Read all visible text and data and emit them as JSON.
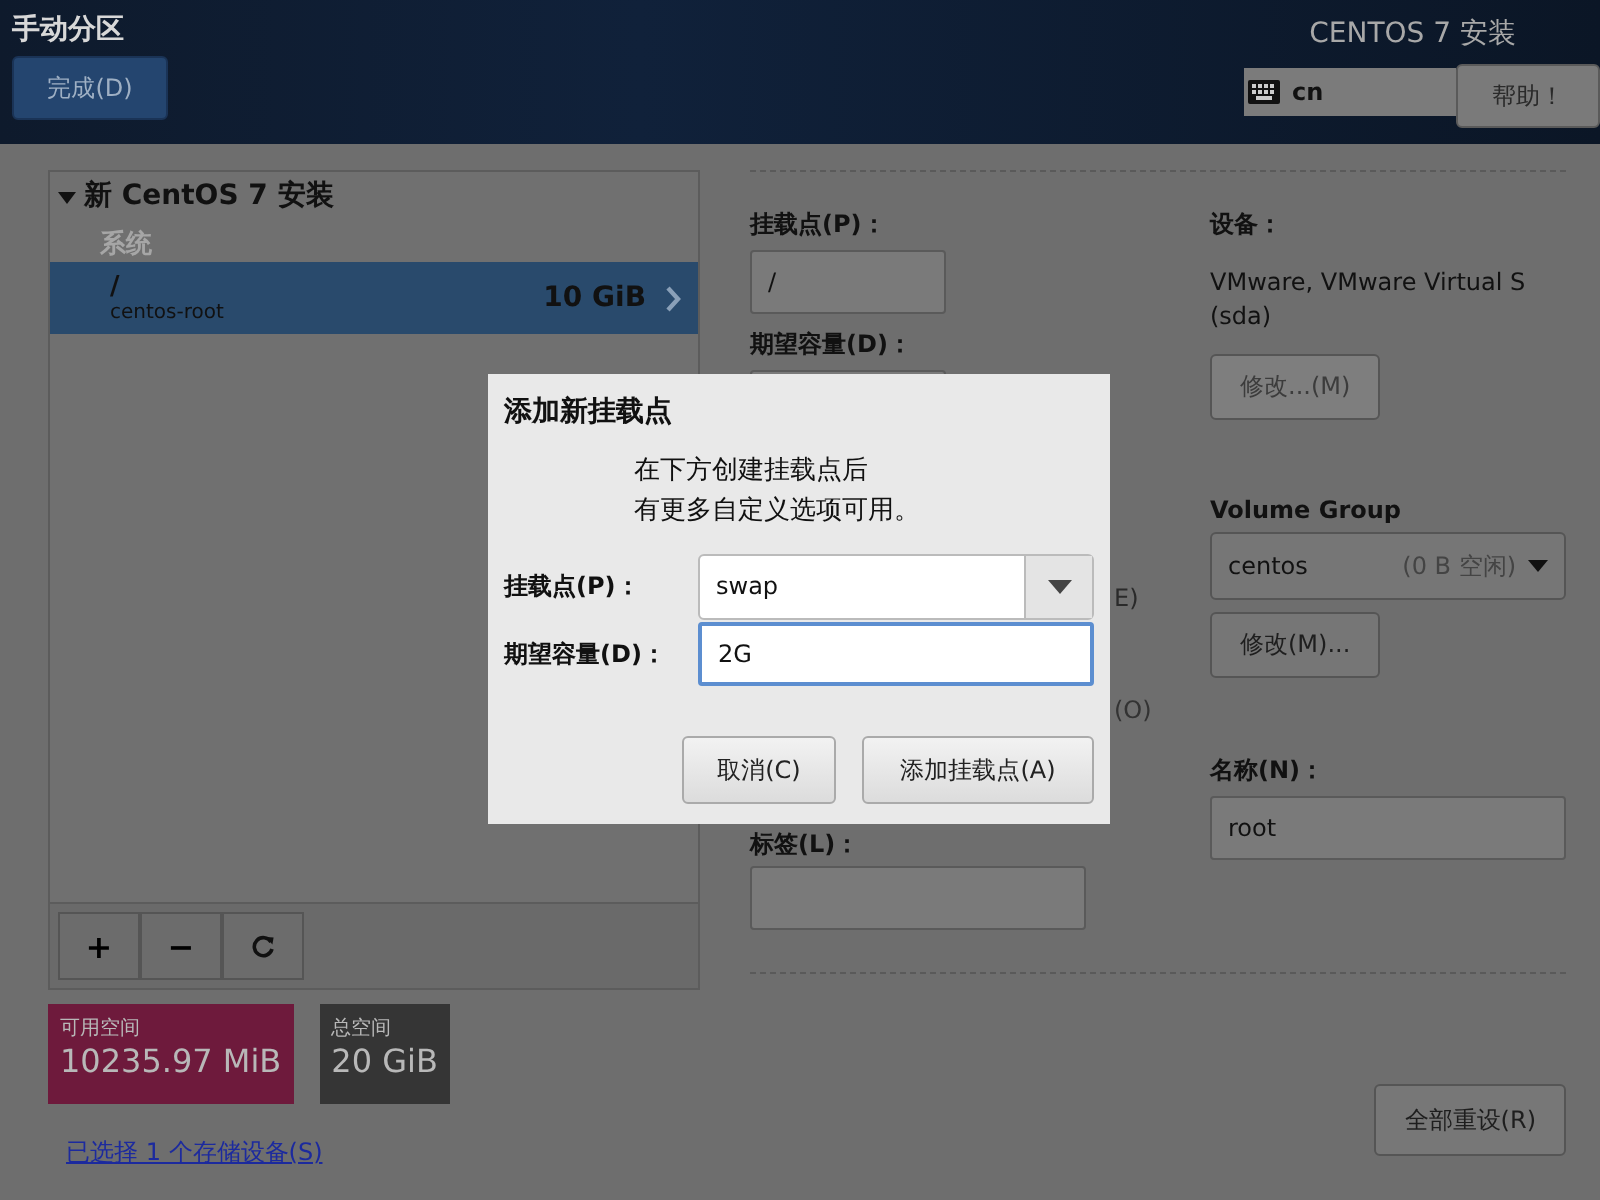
{
  "header": {
    "title": "手动分区",
    "done_button": "完成(D)",
    "product": "CENTOS 7 安装",
    "keyboard_layout": "cn",
    "help_button": "帮助！"
  },
  "partition_tree": {
    "label": "新 CentOS 7 安装",
    "expanded": true,
    "children": [
      {
        "label": "系统",
        "children": [
          {
            "mount": "/",
            "device": "centos-root",
            "size": "10 GiB",
            "selected": true
          }
        ]
      }
    ]
  },
  "toolbar": {
    "add_button": "+",
    "remove_button": "−"
  },
  "space": [
    {
      "kind": "available",
      "label": "可用空间",
      "value": "10235.97 MiB"
    },
    {
      "kind": "total",
      "label": "总空间",
      "value": "20 GiB"
    }
  ],
  "storage_link": "已选择 1 个存储设备(S)",
  "details": {
    "mount_label": "挂载点(P)：",
    "mount_value": "/",
    "capacity_label": "期望容量(D)：",
    "fragment_1": "E)",
    "fragment_2": "(O)",
    "tag_label": "标签(L)：",
    "device_label": "设备：",
    "device_lines": [
      "VMware, VMware Virtual S",
      "(sda)"
    ],
    "device_modify": {
      "label": "修改...(M)",
      "disabled": true
    },
    "volume_group_label": "Volume Group",
    "volume_group": {
      "name": "centos",
      "free": "(0 B 空闲)"
    },
    "vg_modify": {
      "label": "修改(M)...",
      "disabled": false
    },
    "name_label": "名称(N)：",
    "name_value": "root"
  },
  "reset_button": "全部重设(R)",
  "dialog": {
    "title": "添加新挂载点",
    "message_lines": [
      "在下方创建挂载点后",
      "有更多自定义选项可用。"
    ],
    "mount_label": "挂载点(P)：",
    "mount_value": "swap",
    "capacity_label": "期望容量(D)：",
    "capacity_value": "2G",
    "capacity_focused": true,
    "buttons": [
      "取消(C)",
      "添加挂载点(A)"
    ]
  }
}
